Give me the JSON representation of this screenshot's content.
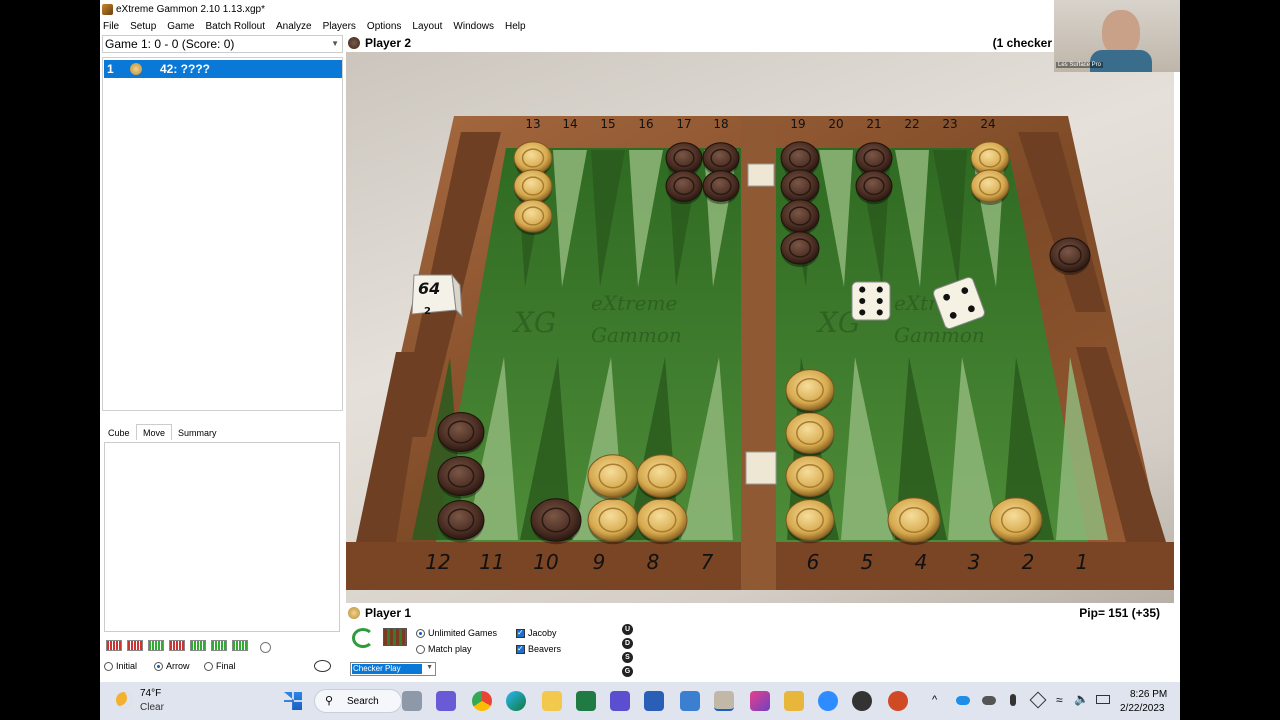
{
  "window": {
    "title": "eXtreme Gammon 2.10 1.13.xgp*"
  },
  "menu": [
    "File",
    "Setup",
    "Game",
    "Batch Rollout",
    "Analyze",
    "Players",
    "Options",
    "Layout",
    "Windows",
    "Help"
  ],
  "game_select": {
    "value": "Game 1: 0 - 0 (Score: 0)"
  },
  "move_list": {
    "rows": [
      {
        "num": "1",
        "move": "42: ????"
      }
    ]
  },
  "tabs": [
    "Cube",
    "Move",
    "Summary"
  ],
  "radios": [
    "Initial",
    "Arrow",
    "Final"
  ],
  "player2": {
    "name": "Player 2",
    "status": "(1 checker"
  },
  "player1": {
    "name": "Player 1",
    "pip": "Pip= 151 (+35)"
  },
  "board": {
    "brand": [
      "eXtreme",
      "Gammon"
    ],
    "top_points": [
      "13",
      "14",
      "15",
      "16",
      "17",
      "18",
      "19",
      "20",
      "21",
      "22",
      "23",
      "24"
    ],
    "bottom_points": [
      "12",
      "11",
      "10",
      "9",
      "8",
      "7",
      "6",
      "5",
      "4",
      "3",
      "2",
      "1"
    ],
    "cube_value": "64",
    "cube_side": "2",
    "dice": [
      4,
      6
    ],
    "colors": {
      "felt": "#3f7d2e",
      "frame": "#8a5230",
      "light_checker": "#d9b061",
      "dark_checker": "#4b2f25"
    }
  },
  "controls": {
    "unlimited": "Unlimited Games",
    "match": "Match play",
    "jacoby": "Jacoby",
    "beavers": "Beavers",
    "mode": "Checker Play",
    "udsg": [
      "U",
      "D",
      "S",
      "G"
    ]
  },
  "webcam": {
    "caption": "Les Surface Pro"
  },
  "taskbar": {
    "weather_temp": "74°F",
    "weather_desc": "Clear",
    "search": "Search",
    "time": "8:26 PM",
    "date": "2/22/2023"
  }
}
